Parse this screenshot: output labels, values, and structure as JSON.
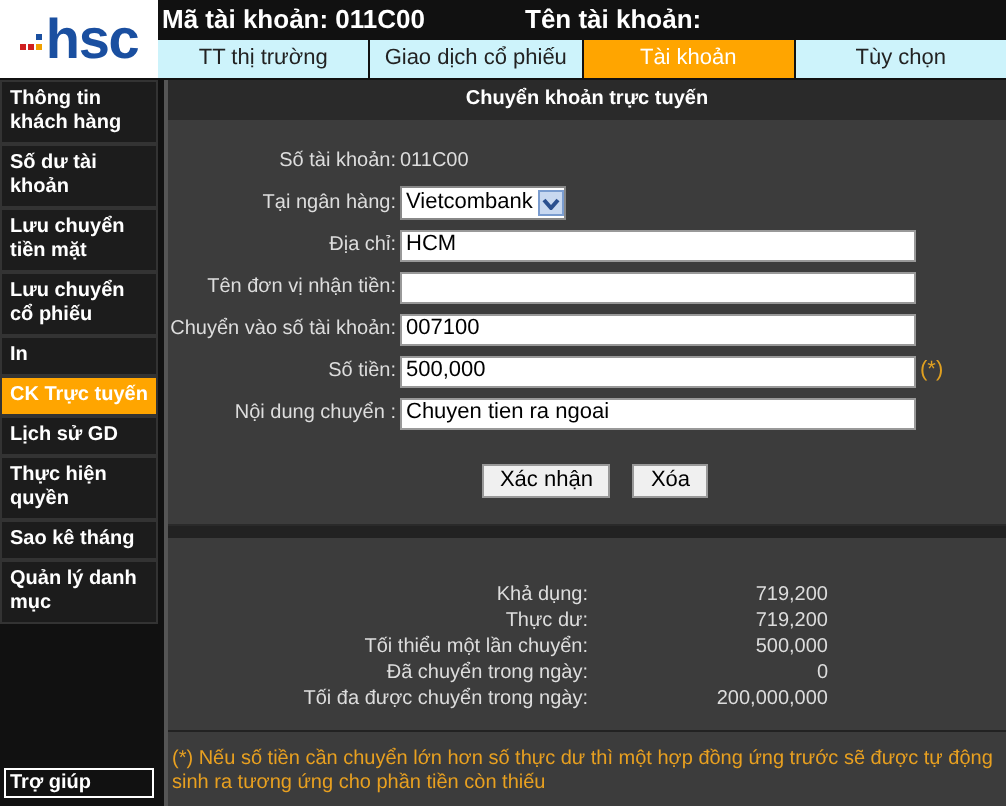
{
  "logo": {
    "text": "hsc"
  },
  "header": {
    "account_code_label": "Mã tài khoản: 011C00",
    "account_name_label": "Tên tài khoản:"
  },
  "tabs": [
    {
      "label": "TT thị trường",
      "selected": false
    },
    {
      "label": "Giao dịch cổ phiếu",
      "selected": false
    },
    {
      "label": "Tài khoản",
      "selected": true
    },
    {
      "label": "Tùy chọn",
      "selected": false
    }
  ],
  "sidebar": {
    "items": [
      {
        "label": "Thông tin khách hàng",
        "selected": false
      },
      {
        "label": "Số dư tài khoản",
        "selected": false
      },
      {
        "label": "Lưu chuyển tiền mặt",
        "selected": false
      },
      {
        "label": "Lưu chuyển cổ phiếu",
        "selected": false
      },
      {
        "label": "In",
        "selected": false
      },
      {
        "label": "CK Trực tuyến",
        "selected": true
      },
      {
        "label": "Lịch sử GD",
        "selected": false
      },
      {
        "label": "Thực hiện quyền",
        "selected": false
      },
      {
        "label": "Sao kê tháng",
        "selected": false
      },
      {
        "label": "Quản lý danh mục",
        "selected": false
      }
    ],
    "help": "Trợ giúp"
  },
  "panel_title": "Chuyển khoản trực tuyến",
  "form": [
    {
      "kind": "static",
      "label": "Số tài khoản:",
      "value": "011C00"
    },
    {
      "kind": "select",
      "label": "Tại ngân hàng:",
      "value": "Vietcombank"
    },
    {
      "kind": "input",
      "label": "Địa chỉ:",
      "value": "HCM"
    },
    {
      "kind": "input",
      "label": "Tên đơn vị nhận tiền:"
    },
    {
      "kind": "input",
      "label": "Chuyển vào số tài khoản:",
      "value": "007100"
    },
    {
      "kind": "input",
      "label": "Số tiền:",
      "value": "500,000",
      "note": "(*)"
    },
    {
      "kind": "input",
      "label": "Nội dung chuyển :",
      "value": "Chuyen tien ra ngoai"
    }
  ],
  "buttons": [
    "Xác nhận",
    "Xóa"
  ],
  "summary": [
    {
      "label": "Khả dụng:",
      "value": "719,200"
    },
    {
      "label": "Thực dư:",
      "value": "719,200"
    },
    {
      "label": "Tối thiểu một lần chuyển:",
      "value": "500,000"
    },
    {
      "label": "Đã chuyển trong ngày:",
      "value": "0"
    },
    {
      "label": "Tối đa được chuyển trong ngày:",
      "value": "200,000,000"
    }
  ],
  "footnote": "(*) Nếu số tiền cần chuyển lớn hơn số thực dư thì một hợp đồng ứng trước sẽ được tự động sinh ra tương ứng cho phần tiền còn thiếu"
}
